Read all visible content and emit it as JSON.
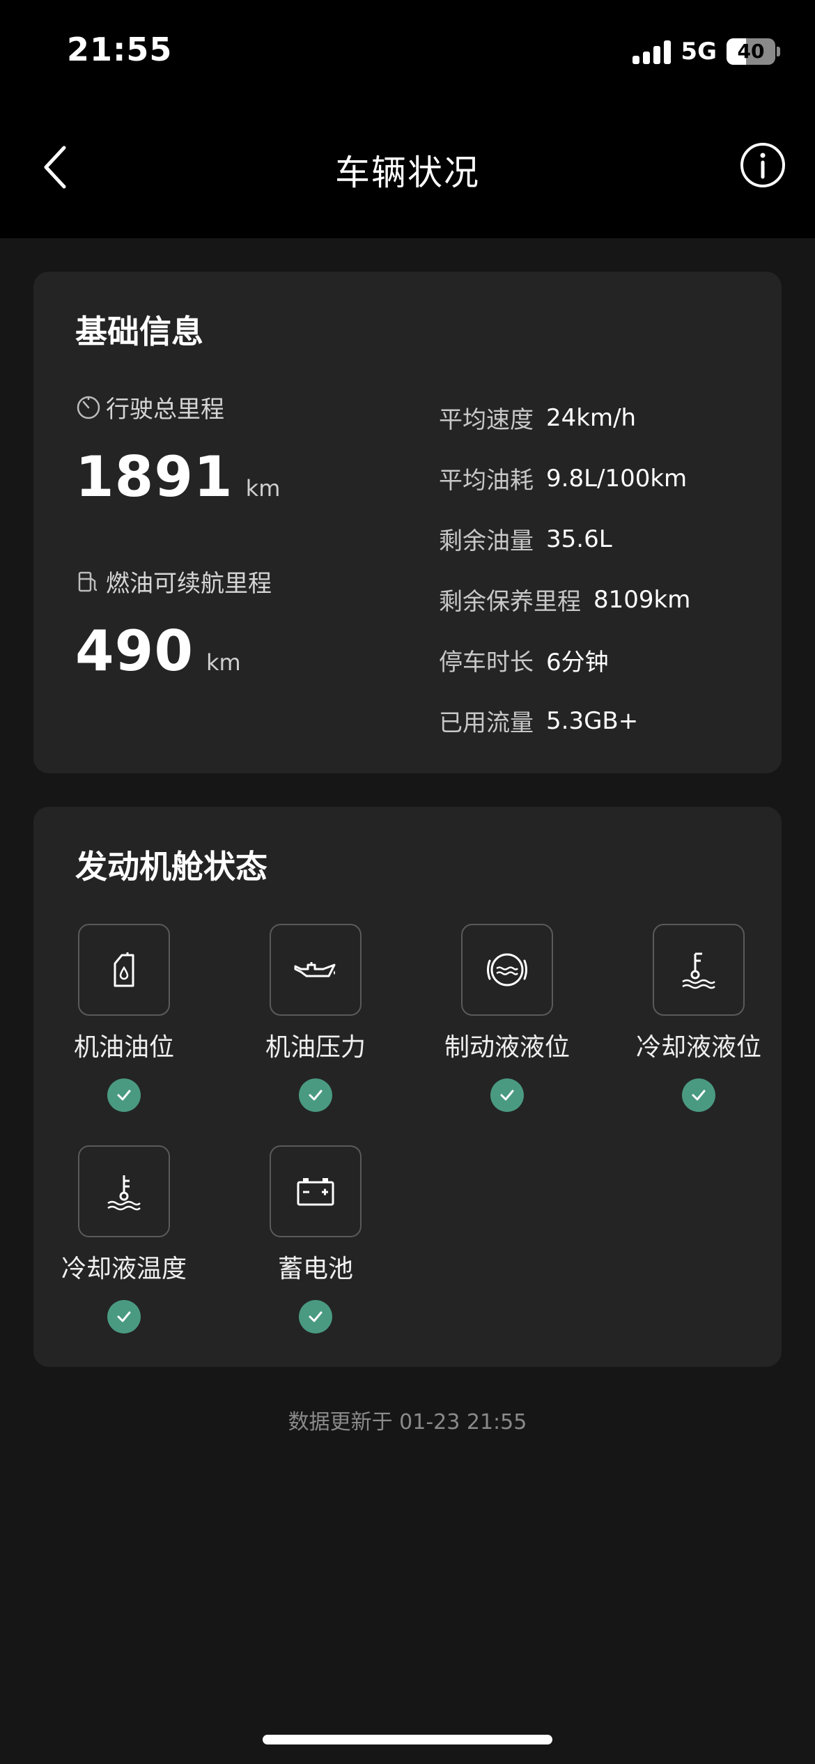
{
  "status_bar": {
    "time": "21:55",
    "network": "5G",
    "battery_percent": "40",
    "battery_level": 0.4
  },
  "nav": {
    "title": "车辆状况",
    "back_icon": "chevron-left-icon",
    "info_icon": "info-circle-icon"
  },
  "basic_info": {
    "title": "基础信息",
    "total_mileage": {
      "label": "行驶总里程",
      "value": "1891",
      "unit": "km",
      "icon": "gauge-icon"
    },
    "fuel_range": {
      "label": "燃油可续航里程",
      "value": "490",
      "unit": "km",
      "icon": "fuel-pump-icon"
    },
    "stats": [
      {
        "label": "平均速度",
        "value": "24km/h"
      },
      {
        "label": "平均油耗",
        "value": "9.8L/100km"
      },
      {
        "label": "剩余油量",
        "value": "35.6L"
      },
      {
        "label": "剩余保养里程",
        "value": "8109km"
      },
      {
        "label": "停车时长",
        "value": "6分钟"
      },
      {
        "label": "已用流量",
        "value": "5.3GB+"
      }
    ]
  },
  "engine": {
    "title": "发动机舱状态",
    "items": [
      {
        "label": "机油油位",
        "icon": "oil-level-icon",
        "status": "ok"
      },
      {
        "label": "机油压力",
        "icon": "oil-pressure-icon",
        "status": "ok"
      },
      {
        "label": "制动液液位",
        "icon": "brake-fluid-icon",
        "status": "ok"
      },
      {
        "label": "冷却液液位",
        "icon": "coolant-level-icon",
        "status": "ok"
      },
      {
        "label": "冷却液温度",
        "icon": "coolant-temperature-icon",
        "status": "ok"
      },
      {
        "label": "蓄电池",
        "icon": "battery-icon",
        "status": "ok"
      }
    ]
  },
  "footer": {
    "update_text": "数据更新于 01-23 21:55"
  },
  "colors": {
    "background": "#161616",
    "card": "#242424",
    "status_ok": "#4a9a82"
  }
}
